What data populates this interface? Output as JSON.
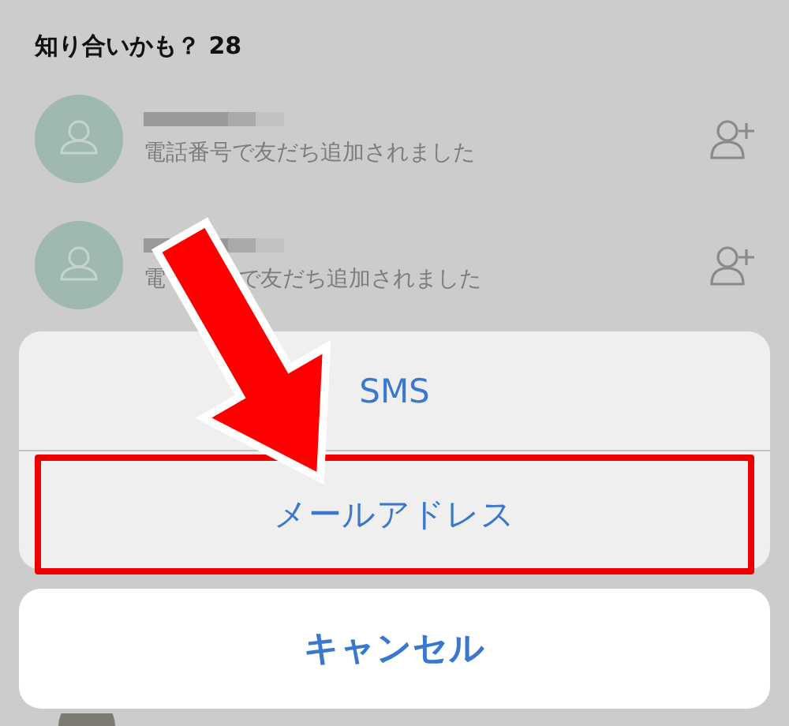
{
  "section": {
    "title": "知り合いかも？ 28"
  },
  "suggestions": [
    {
      "subtitle_parts": [
        "電話番号で友だち追加されました"
      ]
    },
    {
      "subtitle_parts": [
        "電",
        "で友だち追加されました"
      ]
    }
  ],
  "action_sheet": {
    "options": [
      {
        "label": "SMS",
        "highlighted": false
      },
      {
        "label": "メールアドレス",
        "highlighted": true
      }
    ],
    "cancel": "キャンセル"
  }
}
